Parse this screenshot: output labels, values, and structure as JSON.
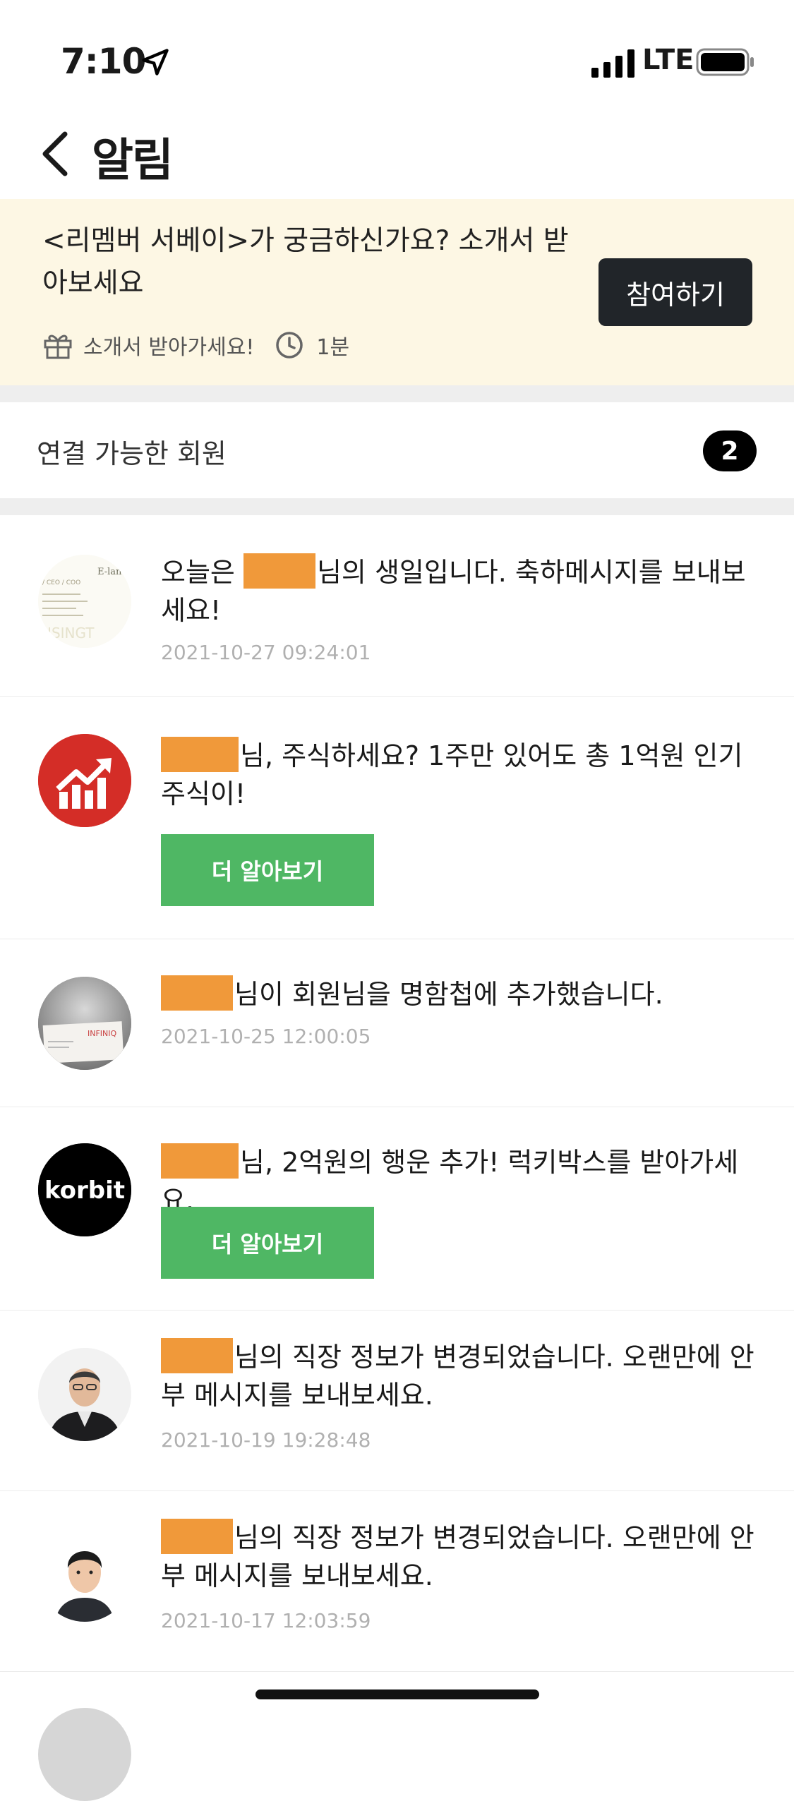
{
  "status_bar": {
    "time": "7:10",
    "network": "LTE"
  },
  "header": {
    "title": "알림",
    "back_icon": "chevron-left-icon"
  },
  "banner": {
    "title": "<리멤버 서베이>가 궁금하신가요? 소개서 받아보세요",
    "reward": "소개서 받아가세요!",
    "duration": "1분",
    "join_label": "참여하기",
    "background": "#fdf7e4",
    "button_color": "#212529"
  },
  "connect": {
    "label": "연결 가능한 회원",
    "count": "2"
  },
  "notifications": [
    {
      "prefix": "오늘은 ",
      "text": "님의 생일입니다. 축하메시지를 보내보세요!",
      "date": "2021-10-27 09:24:01",
      "avatar": "business-card"
    },
    {
      "prefix": "",
      "text": "님, 주식하세요? 1주만 있어도 총 1억원 인기주식이!",
      "button": "더 알아보기",
      "avatar": "stock-chart-logo"
    },
    {
      "prefix": "",
      "text": "님이 회원님을 명함첩에 추가했습니다.",
      "date": "2021-10-25 12:00:05",
      "avatar": "business-card-photo"
    },
    {
      "prefix": "",
      "text": "님, 2억원의 행운 추가! 럭키박스를 받아가세요.",
      "button": "더 알아보기",
      "avatar": "korbit-logo",
      "avatar_text": "korbit"
    },
    {
      "prefix": "",
      "text": "님의 직장 정보가 변경되었습니다. 오랜만에 안부 메시지를 보내보세요.",
      "date": "2021-10-19 19:28:48",
      "avatar": "person-photo"
    },
    {
      "prefix": "",
      "text": "님의 직장 정보가 변경되었습니다. 오랜만에 안부 메시지를 보내보세요.",
      "date": "2021-10-17 12:03:59",
      "avatar": "person-photo"
    }
  ],
  "colors": {
    "redaction": "#f0993a",
    "action_button": "#4fb764",
    "date_text": "#b0b0b0"
  }
}
